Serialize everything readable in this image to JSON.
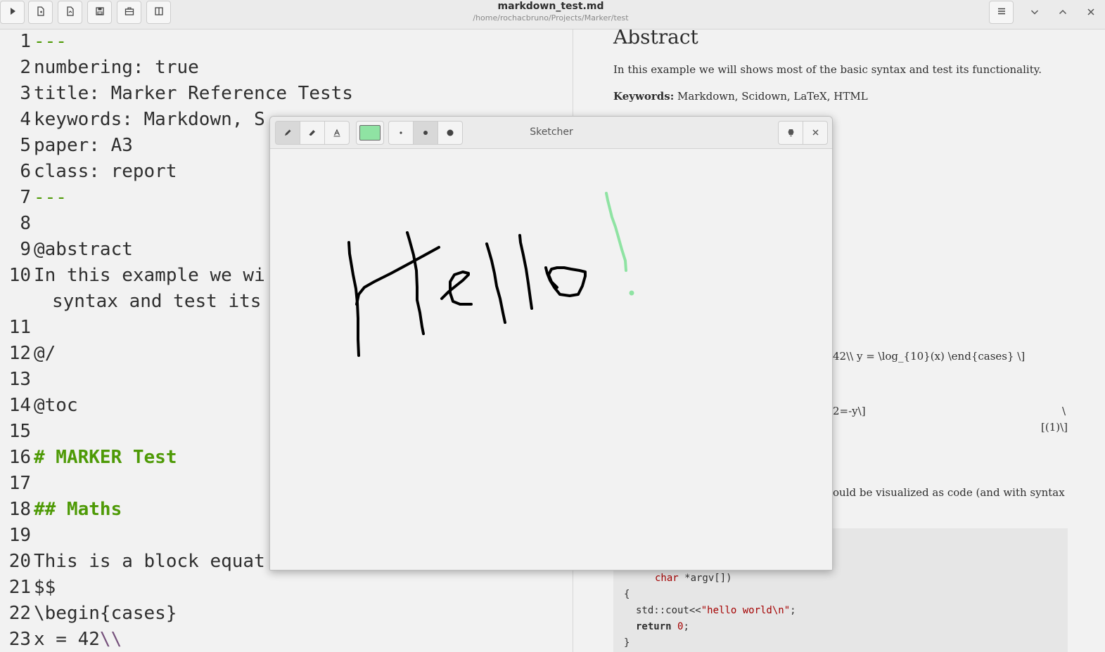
{
  "window": {
    "title": "markdown_test.md",
    "subtitle": "/home/rochacbruno/Projects/Marker/test"
  },
  "toolbar": {
    "buttons": [
      "run-icon",
      "new-file-icon",
      "open-file-icon",
      "save-icon",
      "export-icon",
      "split-view-icon"
    ],
    "menu_icon": "hamburger-menu-icon",
    "window_controls": [
      "minimize-icon",
      "maximize-icon",
      "close-icon"
    ]
  },
  "editor": {
    "lines": [
      {
        "n": "1",
        "text": "---"
      },
      {
        "n": "2",
        "text": "numbering: true"
      },
      {
        "n": "3",
        "text": "title: Marker Reference Tests"
      },
      {
        "n": "4",
        "text": "keywords: Markdown, S"
      },
      {
        "n": "5",
        "text": "paper: A3"
      },
      {
        "n": "6",
        "text": "class: report"
      },
      {
        "n": "7",
        "text": "---"
      },
      {
        "n": "8",
        "text": ""
      },
      {
        "n": "9",
        "text": "@abstract"
      },
      {
        "n": "10",
        "text": "In this example we wi"
      },
      {
        "n": "",
        "text": "syntax and test its f"
      },
      {
        "n": "11",
        "text": ""
      },
      {
        "n": "12",
        "text": "@/"
      },
      {
        "n": "13",
        "text": ""
      },
      {
        "n": "14",
        "text": "@toc"
      },
      {
        "n": "15",
        "text": ""
      },
      {
        "n": "16",
        "text": "# MARKER Test"
      },
      {
        "n": "17",
        "text": ""
      },
      {
        "n": "18",
        "text": "## Maths"
      },
      {
        "n": "19",
        "text": ""
      },
      {
        "n": "20",
        "text": "This is a block equat"
      },
      {
        "n": "21",
        "text": "$$"
      },
      {
        "n": "22",
        "text": "\\begin{cases}"
      },
      {
        "n": "23",
        "text": "x = 42"
      },
      {
        "n": "",
        "text": "\\\\"
      }
    ]
  },
  "preview": {
    "abstract_heading": "Abstract",
    "abstract_text": "In this example we will shows most of the basic syntax and test its functionality.",
    "keywords_label": "Keywords:",
    "keywords_value": " Markdown, Scidown, LaTeX, HTML",
    "frag_cases": "42\\\\ y = \\log_{10}(x) \\end{cases} \\]",
    "frag_eq": "2=-y\\]",
    "frag_backslash": "\\",
    "frag_label": "[(1)\\]",
    "frag_code_text": "ould be visualized as code (and with syntax",
    "code": {
      "l1a": "char",
      "l1b": " *argv[])",
      "l2": "{",
      "l3a": "std::cout<<",
      "l3b": "\"hello world\\n\"",
      "l3c": ";",
      "l4a": "return",
      "l4b": " ",
      "l4c": "0",
      "l4d": ";",
      "l5": "}"
    }
  },
  "sketcher": {
    "title": "Sketcher",
    "tools": [
      "pencil-icon",
      "eraser-icon",
      "text-tool-icon"
    ],
    "active_tool": "pencil-icon",
    "color": "#8fe3a3",
    "sizes": [
      "small-dot-icon",
      "medium-dot-icon",
      "large-dot-icon"
    ],
    "active_size": "medium-dot-icon",
    "header_buttons": [
      "insert-icon",
      "close-icon"
    ],
    "stroke_black": "#000000",
    "stroke_green": "#8fe3a3"
  },
  "colors": {
    "heading_green": "#4e9a06",
    "string_red": "#a40000"
  }
}
